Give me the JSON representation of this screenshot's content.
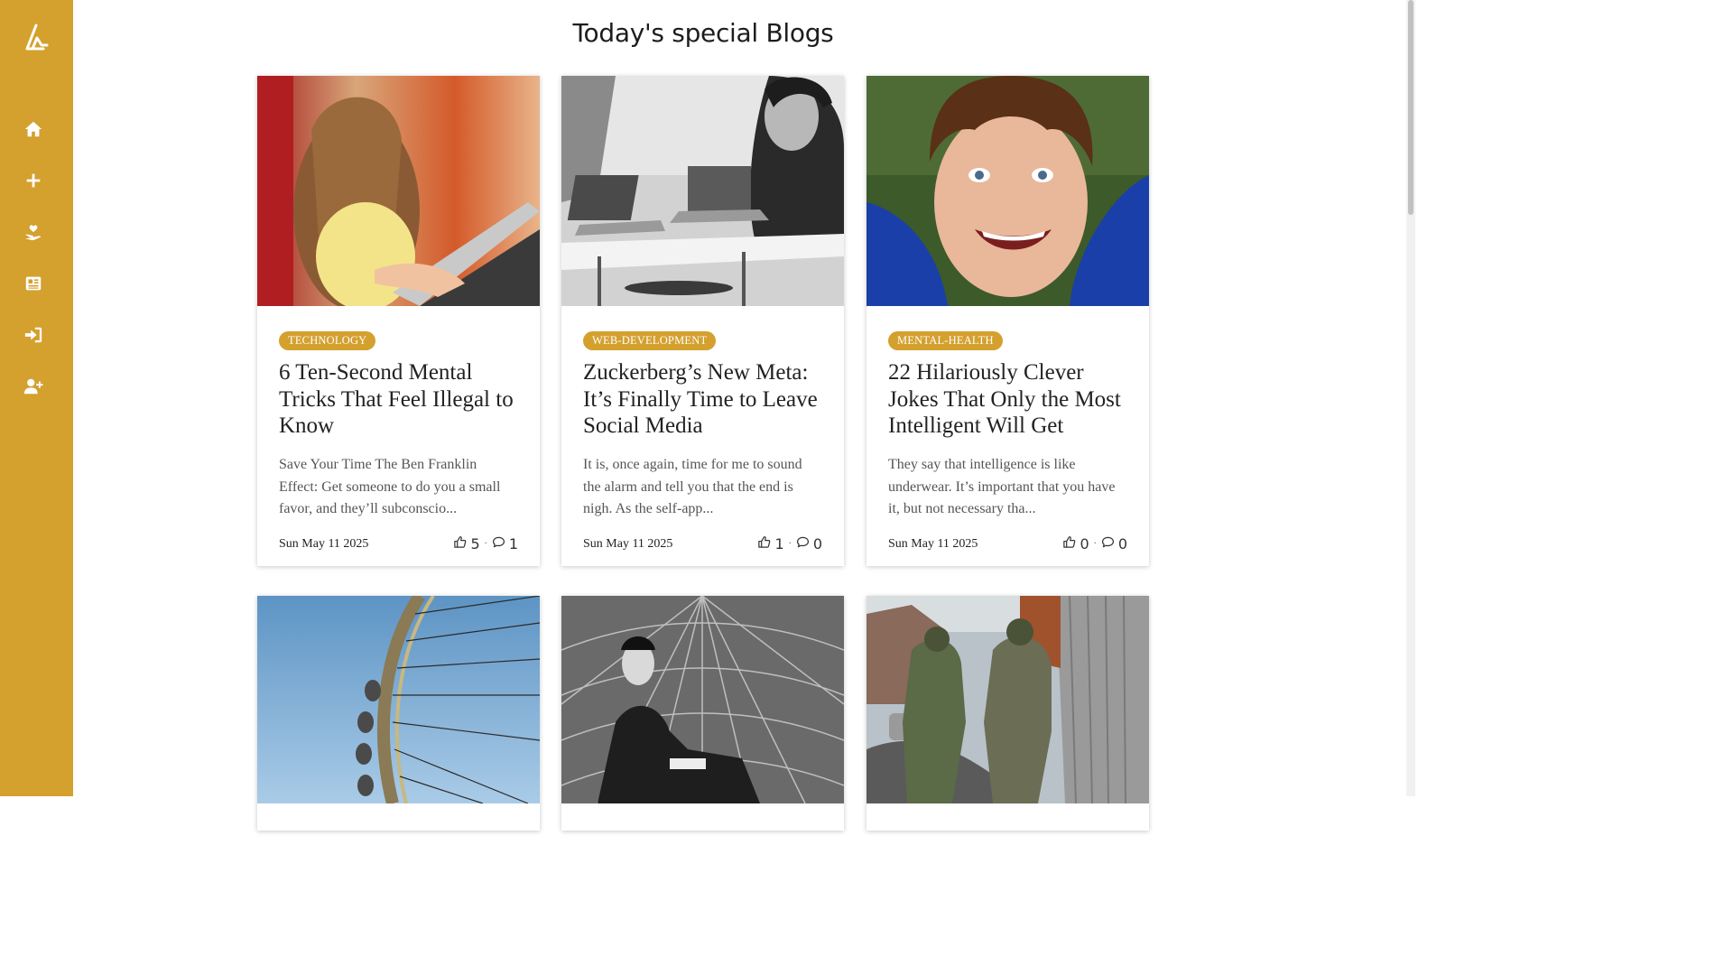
{
  "page": {
    "title": "Today's special Blogs"
  },
  "sidebar": {
    "logo_icon": "brand-logo-icon",
    "items": [
      {
        "icon": "home-icon"
      },
      {
        "icon": "plus-icon"
      },
      {
        "icon": "hand-heart-icon"
      },
      {
        "icon": "newspaper-icon"
      },
      {
        "icon": "sign-in-icon"
      },
      {
        "icon": "user-plus-icon"
      }
    ]
  },
  "colors": {
    "accent": "#d4a02e",
    "text": "#222222",
    "muted": "#555555"
  },
  "blogs": [
    {
      "tag": "TECHNOLOGY",
      "title": "6 Ten-Second Mental Tricks That Feel Illegal to Know",
      "excerpt": "Save Your Time The Ben Franklin Effect: Get someone to do you a small favor, and they’ll subconscio...",
      "date": "Sun May 11 2025",
      "likes": "5",
      "comments": "1"
    },
    {
      "tag": "WEB-DEVELOPMENT",
      "title": "Zuckerberg’s New Meta: It’s Finally Time to Leave Social Media",
      "excerpt": "It is, once again, time for me to sound the alarm and tell you that the end is nigh. As the self-app...",
      "date": "Sun May 11 2025",
      "likes": "1",
      "comments": "0"
    },
    {
      "tag": "MENTAL-HEALTH",
      "title": "22 Hilariously Clever Jokes That Only the Most Intelligent Will Get",
      "excerpt": "They say that intelligence is like underwear. It’s important that you have it, but not necessary tha...",
      "date": "Sun May 11 2025",
      "likes": "0",
      "comments": "0"
    }
  ]
}
